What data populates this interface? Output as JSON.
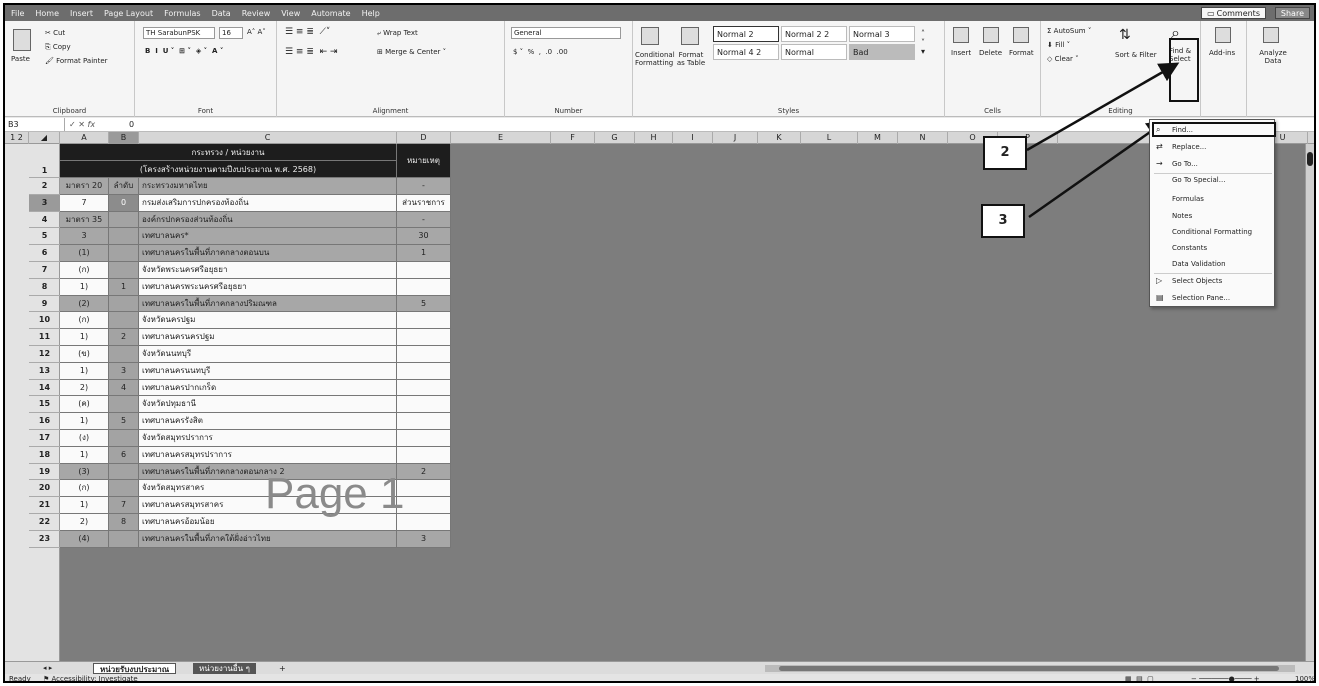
{
  "menubar": {
    "tabs": [
      "File",
      "Home",
      "Insert",
      "Page Layout",
      "Formulas",
      "Data",
      "Review",
      "View",
      "Automate",
      "Help"
    ],
    "comments": "Comments",
    "share": "Share"
  },
  "ribbon": {
    "clipboard": {
      "paste": "Paste",
      "cut": "Cut",
      "copy": "Copy",
      "format_painter": "Format Painter",
      "label": "Clipboard"
    },
    "font": {
      "name": "TH SarabunPSK",
      "size": "16",
      "label": "Font"
    },
    "alignment": {
      "wrap": "Wrap Text",
      "merge": "Merge & Center",
      "label": "Alignment"
    },
    "number": {
      "format": "General",
      "label": "Number"
    },
    "styles": {
      "conditional": "Conditional Formatting",
      "format_as": "Format as Table",
      "cells": [
        "Normal 2",
        "Normal 2 2",
        "Normal 3",
        "Normal 4 2",
        "Normal",
        "Bad"
      ],
      "label": "Styles"
    },
    "cells": {
      "insert": "Insert",
      "delete": "Delete",
      "format": "Format",
      "label": "Cells"
    },
    "editing": {
      "autosum": "AutoSum",
      "fill": "Fill",
      "clear": "Clear",
      "sort": "Sort & Filter",
      "find": "Find & Select",
      "label": "Editing"
    },
    "addins": "Add-ins",
    "analyze": "Analyze Data"
  },
  "formula_bar": {
    "cell": "B3",
    "fx": "fx",
    "value": "0"
  },
  "columns": [
    "A",
    "B",
    "C",
    "D",
    "E",
    "F",
    "G",
    "H",
    "I",
    "J",
    "K",
    "L",
    "M",
    "N",
    "O",
    "P",
    "Q",
    "U"
  ],
  "header_row": {
    "title": "กระทรวง / หน่วยงาน",
    "subtitle": "(โครงสร้างหน่วยงานตามปีงบประมาณ พ.ศ. 2568)",
    "note": "หมายเหตุ"
  },
  "rows": [
    {
      "n": "2",
      "a": "มาตรา 20",
      "b": "ลำดับ",
      "c": "กระทรวงมหาดไทย",
      "d": "-"
    },
    {
      "n": "3",
      "a": "7",
      "b": "0",
      "c": "กรมส่งเสริมการปกครองท้องถิ่น",
      "d": "ส่วนราชการ"
    },
    {
      "n": "4",
      "a": "มาตรา 35",
      "b": "",
      "c": "องค์กรปกครองส่วนท้องถิ่น",
      "d": "-"
    },
    {
      "n": "5",
      "a": "3",
      "b": "",
      "c": "เทศบาลนคร*",
      "d": "30"
    },
    {
      "n": "6",
      "a": "(1)",
      "b": "",
      "c": "เทศบาลนครในพื้นที่ภาคกลางตอนบน",
      "d": "1"
    },
    {
      "n": "7",
      "a": "(ก)",
      "b": "",
      "c": "จังหวัดพระนครศรีอยุธยา",
      "d": ""
    },
    {
      "n": "8",
      "a": "1)",
      "b": "1",
      "c": "เทศบาลนครพระนครศรีอยุธยา",
      "d": ""
    },
    {
      "n": "9",
      "a": "(2)",
      "b": "",
      "c": "เทศบาลนครในพื้นที่ภาคกลางปริมณฑล",
      "d": "5"
    },
    {
      "n": "10",
      "a": "(ก)",
      "b": "",
      "c": "จังหวัดนครปฐม",
      "d": ""
    },
    {
      "n": "11",
      "a": "1)",
      "b": "2",
      "c": "เทศบาลนครนครปฐม",
      "d": ""
    },
    {
      "n": "12",
      "a": "(ข)",
      "b": "",
      "c": "จังหวัดนนทบุรี",
      "d": ""
    },
    {
      "n": "13",
      "a": "1)",
      "b": "3",
      "c": "เทศบาลนครนนทบุรี",
      "d": ""
    },
    {
      "n": "14",
      "a": "2)",
      "b": "4",
      "c": "เทศบาลนครปากเกร็ด",
      "d": ""
    },
    {
      "n": "15",
      "a": "(ค)",
      "b": "",
      "c": "จังหวัดปทุมธานี",
      "d": ""
    },
    {
      "n": "16",
      "a": "1)",
      "b": "5",
      "c": "เทศบาลนครรังสิต",
      "d": ""
    },
    {
      "n": "17",
      "a": "(ง)",
      "b": "",
      "c": "จังหวัดสมุทรปราการ",
      "d": ""
    },
    {
      "n": "18",
      "a": "1)",
      "b": "6",
      "c": "เทศบาลนครสมุทรปราการ",
      "d": ""
    },
    {
      "n": "19",
      "a": "(3)",
      "b": "",
      "c": "เทศบาลนครในพื้นที่ภาคกลางตอนกลาง 2",
      "d": "2"
    },
    {
      "n": "20",
      "a": "(ก)",
      "b": "",
      "c": "จังหวัดสมุทรสาคร",
      "d": ""
    },
    {
      "n": "21",
      "a": "1)",
      "b": "7",
      "c": "เทศบาลนครสมุทรสาคร",
      "d": ""
    },
    {
      "n": "22",
      "a": "2)",
      "b": "8",
      "c": "เทศบาลนครอ้อมน้อย",
      "d": ""
    },
    {
      "n": "23",
      "a": "(4)",
      "b": "",
      "c": "เทศบาลนครในพื้นที่ภาคใต้ฝั่งอ่าวไทย",
      "d": "3"
    }
  ],
  "watermark": "Page 1",
  "sheet_tabs": [
    "หน่วยรับงบประมาณ",
    "หน่วยงานอื่น ๆ",
    "+"
  ],
  "status": {
    "ready": "Ready",
    "accessibility": "Accessibility: Investigate",
    "zoom": "100%"
  },
  "dropdown": {
    "items": [
      {
        "label": "Find...",
        "icon": "search-icon"
      },
      {
        "label": "Replace...",
        "icon": "replace-icon"
      },
      {
        "label": "Go To...",
        "icon": "arrow-icon"
      },
      {
        "label": "Go To Special...",
        "icon": ""
      },
      {
        "label": "Formulas",
        "icon": ""
      },
      {
        "label": "Notes",
        "icon": ""
      },
      {
        "label": "Conditional Formatting",
        "icon": ""
      },
      {
        "label": "Constants",
        "icon": ""
      },
      {
        "label": "Data Validation",
        "icon": ""
      },
      {
        "label": "Select Objects",
        "icon": "cursor-icon"
      },
      {
        "label": "Selection Pane...",
        "icon": "pane-icon"
      }
    ]
  },
  "callouts": [
    "2",
    "3"
  ]
}
